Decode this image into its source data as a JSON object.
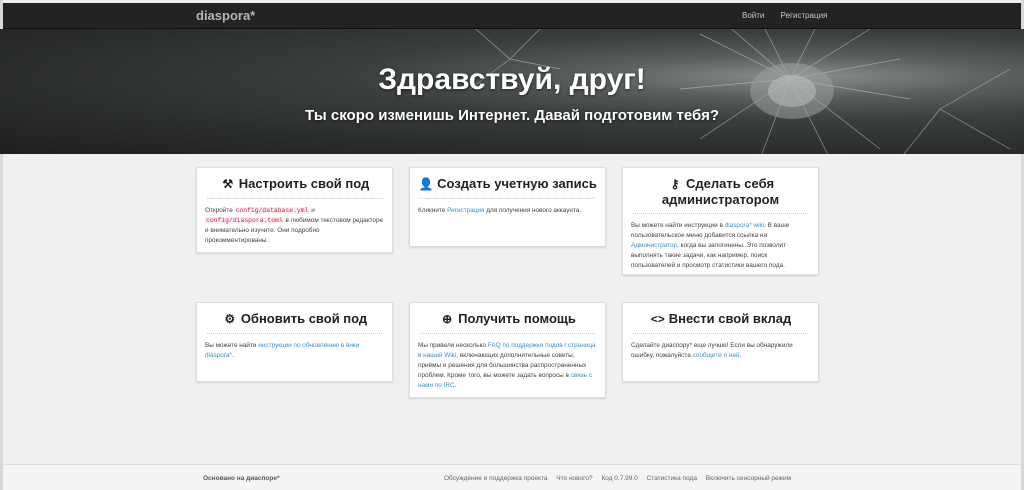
{
  "navbar": {
    "brand": "diaspora*",
    "login": "Войти",
    "register": "Регистрация"
  },
  "hero": {
    "title": "Здравствуй, друг!",
    "subtitle": "Ты скоро изменишь Интернет. Давай подготовим тебя?"
  },
  "cards": {
    "configure": {
      "icon": "tools-icon",
      "title": "Настроить свой под",
      "t1": "Откройте ",
      "code1": "config/database.yml",
      "t2": " и ",
      "code2": "config/diaspora.toml",
      "t3": " в любимом текстовом редакторе и внимательно изучите. Они подробно прокомментированы."
    },
    "account": {
      "icon": "add-user-icon",
      "title": "Создать учетную запись",
      "t1": "Кликните ",
      "link": "Регистрация",
      "t2": " для получения нового аккаунта."
    },
    "admin": {
      "icon": "key-icon",
      "title": "Сделать себя администратором",
      "t1": "Вы можете найти инструкции в ",
      "link1": "diaspora* wiki",
      "t2": ". В ваше пользовательское меню добавится ссылка на ",
      "link2": "Администратор",
      "t3": ", когда вы залогинены. Это позволит выполнять такие задачи, как например, поиск пользователей и просмотр статистики вашего пода."
    },
    "update": {
      "icon": "gear-icon",
      "title": "Обновить свой под",
      "t1": "Вы можете найти ",
      "link": "инструкции по обновлению в вики diaspora*",
      "t2": "."
    },
    "help": {
      "icon": "lifebuoy-icon",
      "title": "Получить помощь",
      "t1": "Мы привели несколько ",
      "link1": "FAQ по поддержке подов / страница в нашей Wiki",
      "t2": ", включающих дополнительные советы, приёмы и решения для большинства распространенных проблем. Кроме того, вы можете задать вопросы в ",
      "link2": "связь с нами по IRC",
      "t3": "."
    },
    "contribute": {
      "icon": "code-icon",
      "title": "Внести свой вклад",
      "t1": "Сделайте диаспору* еще лучше! Если вы обнаружили ошибку, пожалуйста ",
      "link": "сообщите о ней",
      "t2": "."
    }
  },
  "footer": {
    "powered": "Основано на диаспоре*",
    "links": [
      "Обсуждение и поддержка проекта",
      "Что нового?",
      "Код 0.7.99.0",
      "Статистика пода",
      "Включить сенсорный режим"
    ]
  },
  "colors": {
    "navbar": "#232323",
    "link": "#3f8fba",
    "background": "#f0f0f0"
  }
}
